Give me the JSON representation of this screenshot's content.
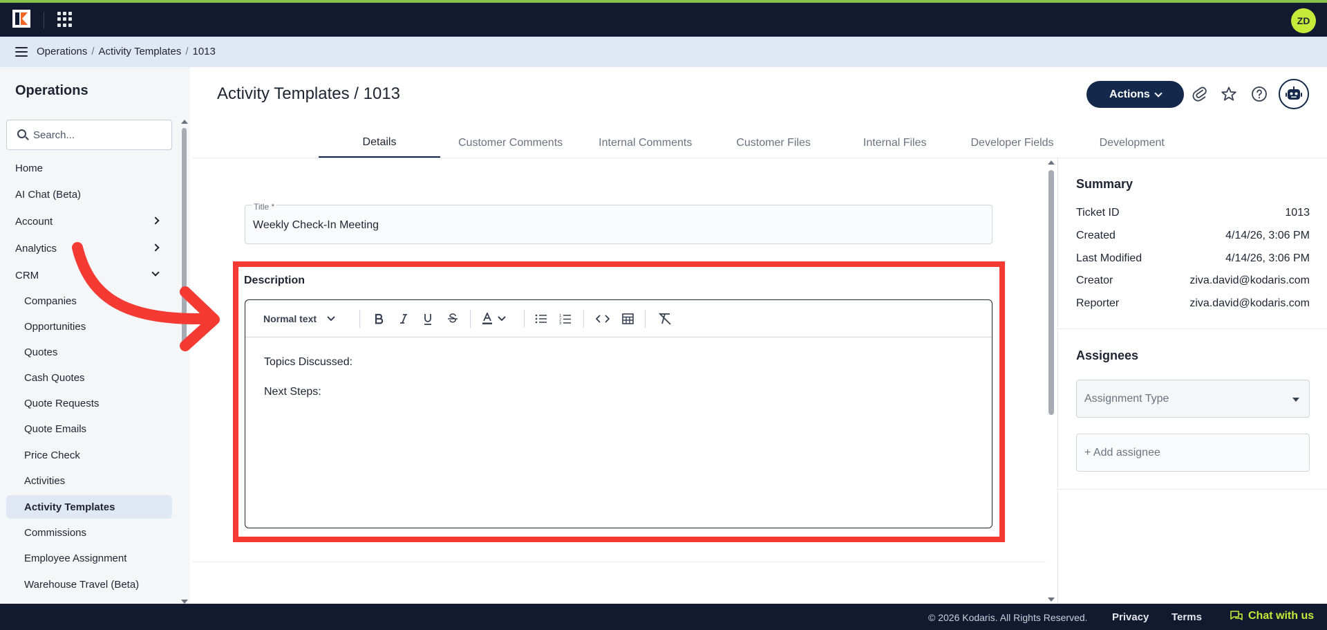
{
  "topbar": {
    "avatar_initials": "ZD",
    "brand_color": "#8bc34a"
  },
  "breadcrumb": {
    "items": [
      "Operations",
      "Activity Templates",
      "1013"
    ],
    "separator": "/"
  },
  "sidebar": {
    "title": "Operations",
    "search_placeholder": "Search...",
    "items": [
      {
        "label": "Home",
        "expandable": false
      },
      {
        "label": "AI Chat (Beta)",
        "expandable": false
      },
      {
        "label": "Account",
        "expandable": true,
        "expanded": false
      },
      {
        "label": "Analytics",
        "expandable": true,
        "expanded": false
      },
      {
        "label": "CRM",
        "expandable": true,
        "expanded": true
      }
    ],
    "crm_items": [
      "Companies",
      "Opportunities",
      "Quotes",
      "Cash Quotes",
      "Quote Requests",
      "Quote Emails",
      "Price Check",
      "Activities",
      "Activity Templates",
      "Commissions",
      "Employee Assignment",
      "Warehouse Travel (Beta)"
    ],
    "active_item": "Activity Templates"
  },
  "header": {
    "title": "Activity Templates / 1013",
    "actions_label": "Actions",
    "icons": [
      "paperclip-icon",
      "star-icon",
      "help-icon",
      "robot-icon"
    ]
  },
  "tabs": [
    "Details",
    "Customer Comments",
    "Internal Comments",
    "Customer Files",
    "Internal Files",
    "Developer Fields",
    "Development"
  ],
  "active_tab": "Details",
  "form": {
    "title_label": "Title *",
    "title_value": "Weekly Check-In Meeting",
    "description_label": "Description",
    "editor": {
      "block_format": "Normal text",
      "tools": [
        "bold-icon",
        "italic-icon",
        "underline-icon",
        "strikethrough-icon",
        "text-color-icon",
        "bullet-list-icon",
        "numbered-list-icon",
        "code-icon",
        "table-icon",
        "clear-formatting-icon"
      ],
      "lines": [
        "Topics Discussed:",
        "Next Steps:"
      ]
    },
    "highlight_color": "#f43a33"
  },
  "summary": {
    "heading": "Summary",
    "rows": [
      {
        "key": "Ticket ID",
        "value": "1013"
      },
      {
        "key": "Created",
        "value": "4/14/26, 3:06 PM"
      },
      {
        "key": "Last Modified",
        "value": "4/14/26, 3:06 PM"
      },
      {
        "key": "Creator",
        "value": "ziva.david@kodaris.com"
      },
      {
        "key": "Reporter",
        "value": "ziva.david@kodaris.com"
      }
    ]
  },
  "assignees": {
    "heading": "Assignees",
    "type_placeholder": "Assignment Type",
    "add_label": "+ Add assignee"
  },
  "footer": {
    "copyright": "© 2026 Kodaris. All Rights Reserved.",
    "privacy": "Privacy",
    "terms": "Terms",
    "chat": "Chat with us"
  }
}
